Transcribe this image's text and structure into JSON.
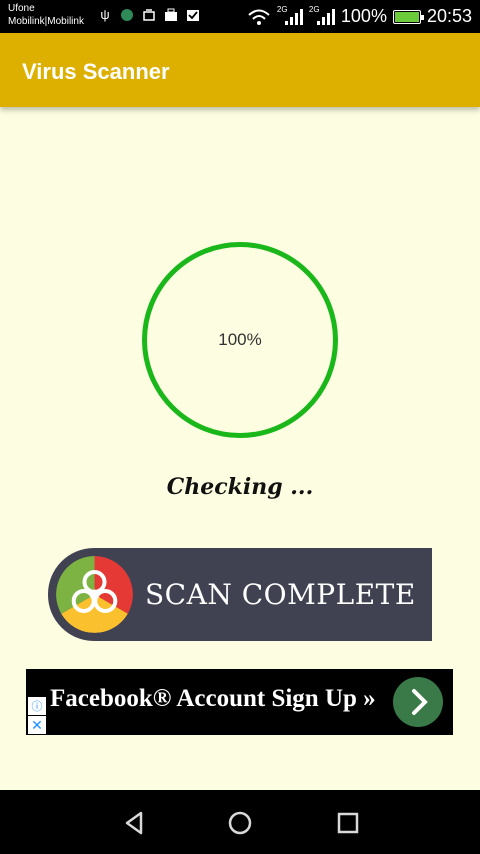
{
  "status_bar": {
    "carrier_line1": "Ufone",
    "carrier_line2": "Mobilink|Mobilink",
    "left_icons": [
      "usb-icon",
      "app-icon",
      "notification-icon",
      "briefcase-icon",
      "tick-icon"
    ],
    "network_1": "2G",
    "network_2": "2G",
    "battery_percent": "100%",
    "battery_level": 1.0,
    "time": "20:53"
  },
  "app_bar": {
    "title": "Virus Scanner",
    "color": "#ddb000"
  },
  "progress": {
    "label": "100%",
    "ring_color": "#19b719"
  },
  "status_text": "Checking ...",
  "scan_button": {
    "label": "SCAN COMPLETE",
    "background": "#404252"
  },
  "ad": {
    "text": "Facebook® Account Sign Up »",
    "arrow_color": "#3a7a48"
  },
  "nav": {
    "back": "back-icon",
    "home": "home-icon",
    "recents": "recents-icon"
  }
}
